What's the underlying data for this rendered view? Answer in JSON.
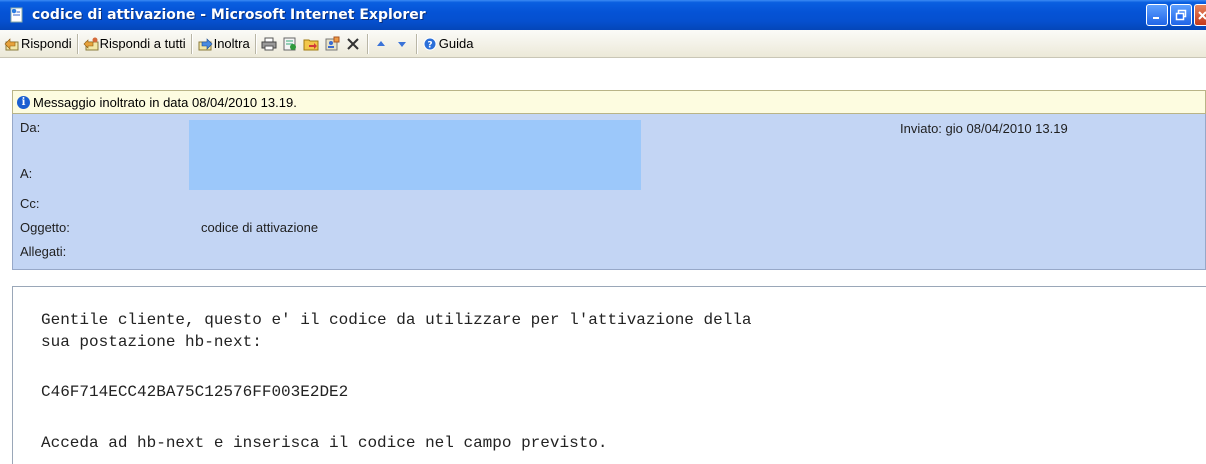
{
  "window": {
    "title": "codice di attivazione - Microsoft Internet Explorer",
    "titlebar_color": "#0553d6"
  },
  "toolbar": {
    "reply_label": "Rispondi",
    "reply_all_label": "Rispondi a tutti",
    "forward_label": "Inoltra",
    "help_label": "Guida",
    "icons": [
      "reply-icon",
      "reply-all-icon",
      "forward-icon",
      "print-icon",
      "save-icon",
      "folder-icon",
      "address-book-icon",
      "delete-icon",
      "previous-icon",
      "next-icon",
      "help-icon"
    ]
  },
  "infobar": {
    "text": "Messaggio inoltrato in data 08/04/2010 13.19."
  },
  "header": {
    "from_label": "Da:",
    "to_label": "A:",
    "cc_label": "Cc:",
    "subject_label": "Oggetto:",
    "attachments_label": "Allegati:",
    "subject_value": "codice di attivazione",
    "sent_label": "Inviato:",
    "sent_value": "gio 08/04/2010 13.19",
    "background_color": "#c3d5f4"
  },
  "body": {
    "line1": "Gentile cliente, questo e' il codice da utilizzare per l'attivazione della",
    "line2": "sua postazione hb-next:",
    "code": "C46F714ECC42BA75C12576FF003E2DE2",
    "line3": "Acceda ad hb-next e inserisca il codice nel campo previsto."
  }
}
